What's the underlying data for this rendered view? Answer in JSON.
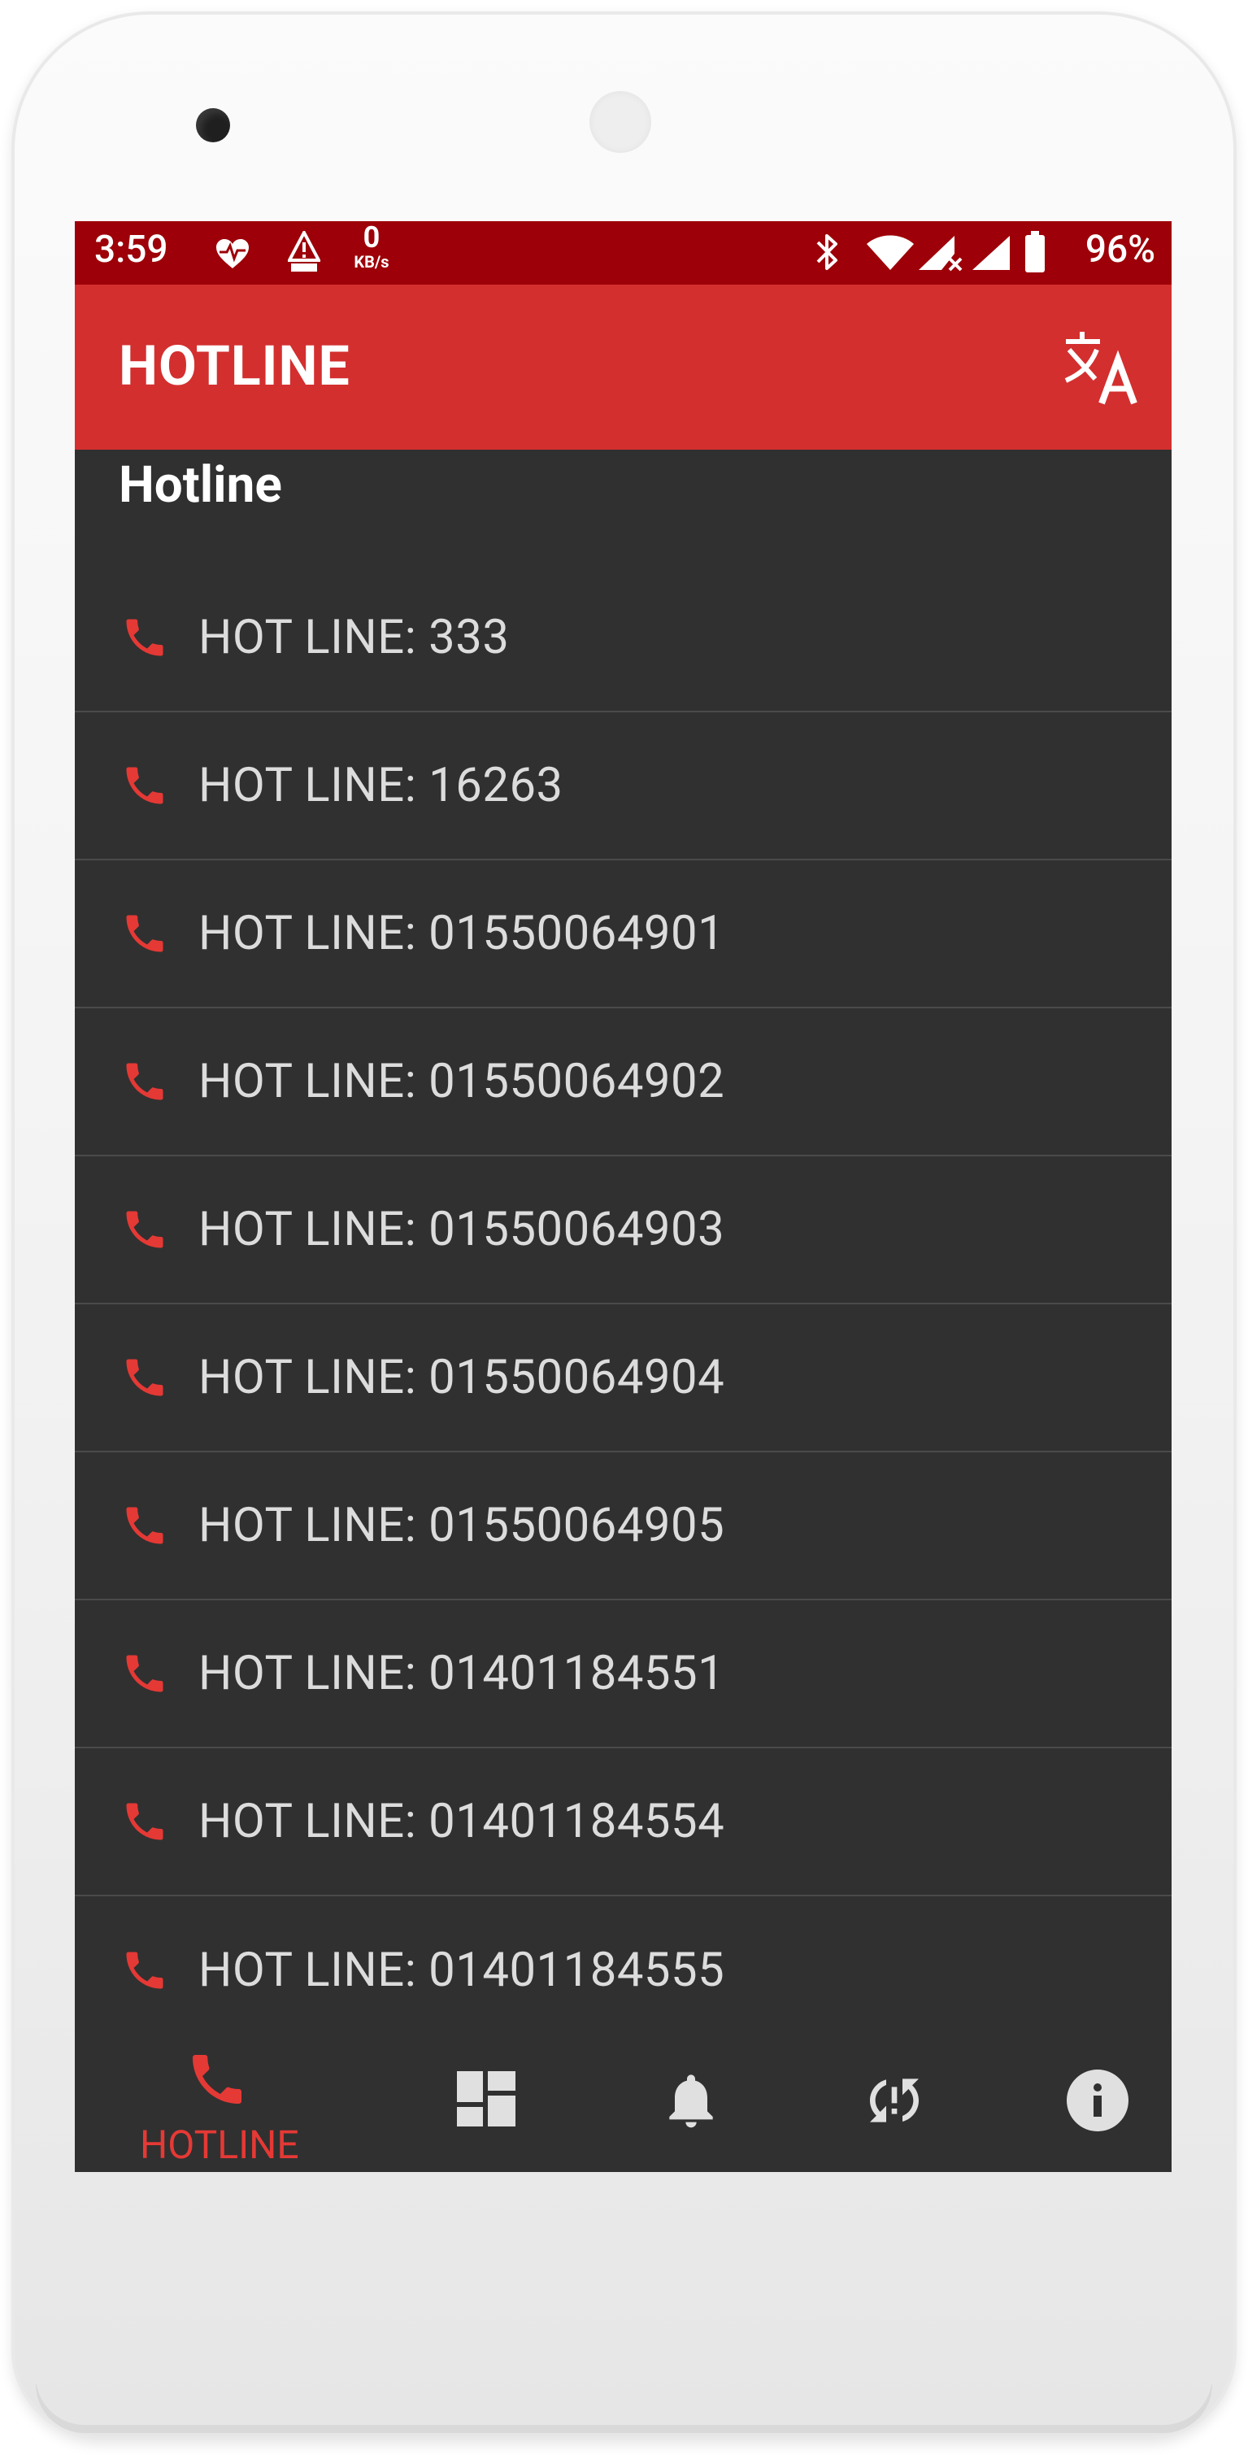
{
  "status_bar": {
    "time": "3:59",
    "net_speed_value": "0",
    "net_speed_unit": "KB/s",
    "battery_percent": "96%",
    "icons": [
      "heart-pulse-icon",
      "network-warning-icon",
      "bluetooth-icon",
      "wifi-icon",
      "cellular-nosignal-icon",
      "cellular-icon",
      "battery-icon"
    ]
  },
  "app_bar": {
    "title": "HOTLINE",
    "translate_icon": "translate-icon"
  },
  "section": {
    "heading": "Hotline"
  },
  "hotlines": [
    {
      "label": "HOT LINE: 333"
    },
    {
      "label": "HOT LINE: 16263"
    },
    {
      "label": "HOT LINE: 01550064901"
    },
    {
      "label": "HOT LINE: 01550064902"
    },
    {
      "label": "HOT LINE: 01550064903"
    },
    {
      "label": "HOT LINE: 01550064904"
    },
    {
      "label": "HOT LINE: 01550064905"
    },
    {
      "label": "HOT LINE: 01401184551"
    },
    {
      "label": "HOT LINE: 01401184554"
    },
    {
      "label": "HOT LINE: 01401184555"
    }
  ],
  "bottom_nav": {
    "items": [
      {
        "icon": "phone-icon",
        "label": "HOTLINE",
        "active": true
      },
      {
        "icon": "dashboard-icon",
        "label": "",
        "active": false
      },
      {
        "icon": "bell-icon",
        "label": "",
        "active": false
      },
      {
        "icon": "sync-problem-icon",
        "label": "",
        "active": false
      },
      {
        "icon": "info-icon",
        "label": "",
        "active": false
      }
    ]
  },
  "colors": {
    "status_bar": "#9d0008",
    "app_bar": "#d32f2f",
    "background": "#303030",
    "accent": "#e53935",
    "list_text": "#dcdcdc",
    "icon_inactive": "#e0e0e0"
  }
}
